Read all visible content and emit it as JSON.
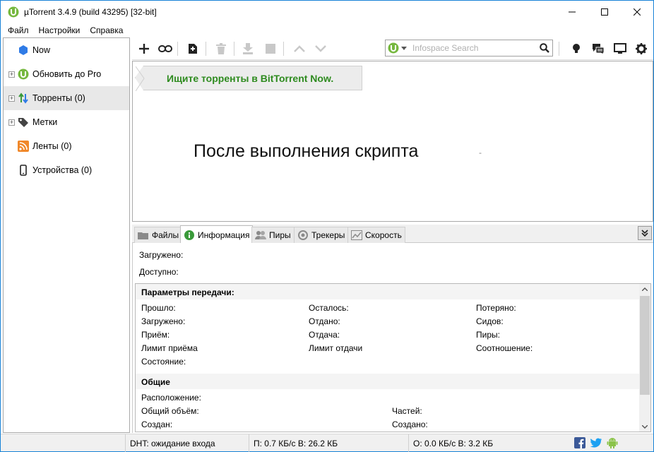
{
  "window": {
    "title": "µTorrent 3.4.9  (build 43295) [32-bit]"
  },
  "menu": [
    "Файл",
    "Настройки",
    "Справка"
  ],
  "sidebar": {
    "items": [
      {
        "label": "Now",
        "icon": "now-icon"
      },
      {
        "label": "Обновить до Pro",
        "icon": "utorrent-icon"
      },
      {
        "label": "Торренты (0)",
        "icon": "torrents-icon"
      },
      {
        "label": "Метки",
        "icon": "tag-icon"
      },
      {
        "label": "Ленты (0)",
        "icon": "rss-icon"
      },
      {
        "label": "Устройства (0)",
        "icon": "device-icon"
      }
    ]
  },
  "search": {
    "placeholder": "Infospace Search"
  },
  "main": {
    "promo": "Ищите торренты в BitTorrent Now.",
    "message": "После выполнения скрипта",
    "dash": "-"
  },
  "tabs": [
    {
      "label": "Файлы",
      "icon": "folder-icon"
    },
    {
      "label": "Информация",
      "icon": "info-icon"
    },
    {
      "label": "Пиры",
      "icon": "peers-icon"
    },
    {
      "label": "Трекеры",
      "icon": "trackers-icon"
    },
    {
      "label": "Скорость",
      "icon": "speed-icon"
    }
  ],
  "info": {
    "downloaded": "Загружено:",
    "available": "Доступно:",
    "transfer_header": "Параметры передачи:",
    "transfer": {
      "col1": [
        "Прошло:",
        "Загружено:",
        "Приём:",
        "Лимит приёма",
        "Состояние:"
      ],
      "col2": [
        "Осталось:",
        "Отдано:",
        "Отдача:",
        "Лимит отдачи"
      ],
      "col3": [
        "Потеряно:",
        "Сидов:",
        "Пиры:",
        "Соотношение:"
      ]
    },
    "general_header": "Общие",
    "general": {
      "col1": [
        "Расположение:",
        "Общий объём:",
        "Создан:"
      ],
      "col2": [
        "Частей:",
        "Создано:"
      ]
    }
  },
  "status": {
    "dht": "DHT: ожидание входа",
    "down": "П: 0.7 КБ/с В: 26.2 КБ",
    "up": "О: 0.0 КБ/с В: 3.2 КБ"
  },
  "colors": {
    "accent_green": "#2e8b1f",
    "utorrent_green": "#76b83f",
    "window_border": "#1883d7"
  }
}
